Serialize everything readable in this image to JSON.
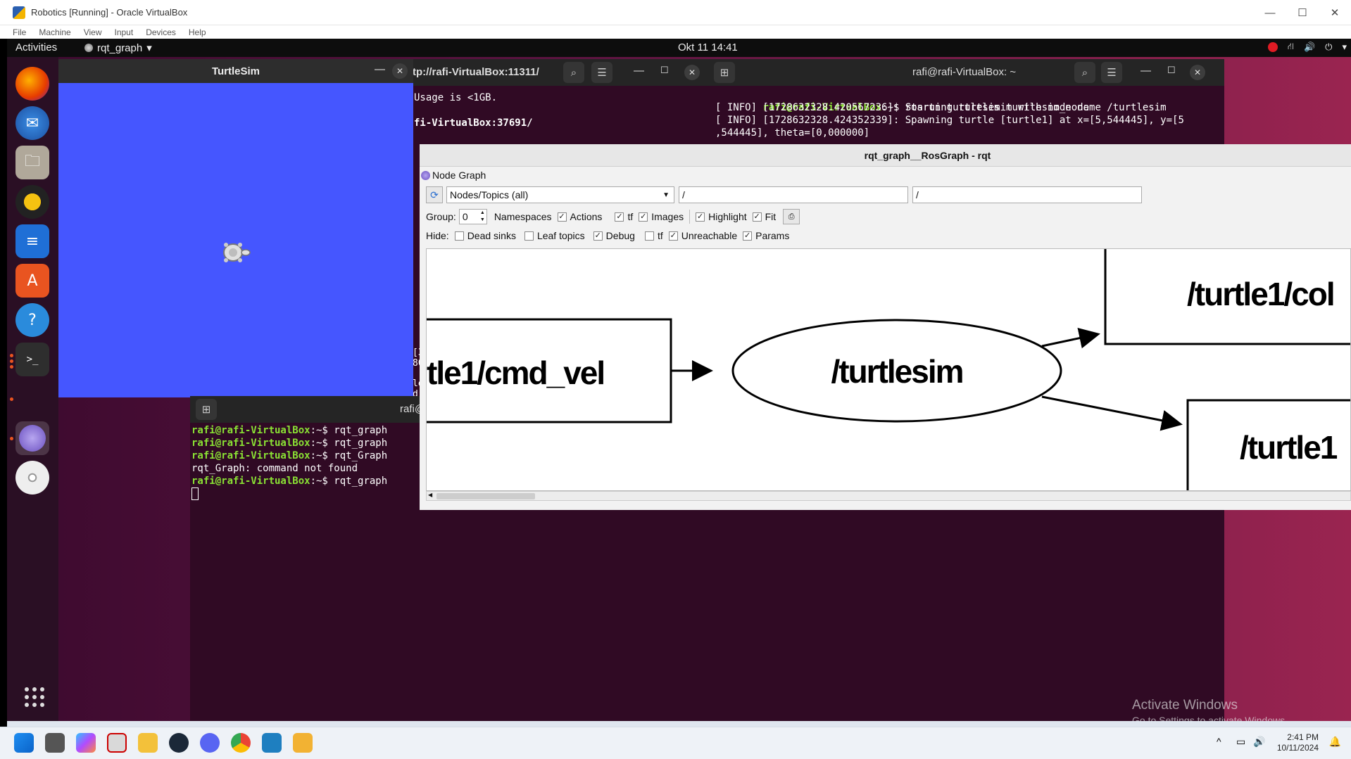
{
  "vbox": {
    "title": "Robotics [Running] - Oracle VirtualBox",
    "menu": [
      "File",
      "Machine",
      "View",
      "Input",
      "Devices",
      "Help"
    ]
  },
  "topbar": {
    "activities": "Activities",
    "app_name": "rqt_graph",
    "clock": "Okt 11  14:41"
  },
  "turtlesim": {
    "title": "TurtleSim"
  },
  "terminal_back": {
    "title": "tp://rafi-VirtualBox:11311/",
    "lines": [
      "Usage is <1GB.",
      "",
      "fi-VirtualBox:37691/"
    ],
    "fragments": [
      "[3",
      "80",
      "le",
      "d"
    ]
  },
  "terminal_right": {
    "title": "rafi@rafi-VirtualBox: ~",
    "prompt": "rafi@rafi-VirtualBox",
    "prompt_suffix": ":~$ ",
    "command": "rosrun turtlesim turtlesim_node",
    "lines": [
      "[ INFO] [1728632328.420567236]: Starting turtlesim with node name /turtlesim",
      "[ INFO] [1728632328.424352339]: Spawning turtle [turtle1] at x=[5,544445], y=[5",
      ",544445], theta=[0,000000]"
    ]
  },
  "terminal_front": {
    "title": "rafi@",
    "prompt": "rafi@rafi-VirtualBox",
    "prompt_suffix": ":~$ ",
    "commands": [
      "rqt_graph",
      "rqt_graph",
      "rqt_Graph",
      "rqt_graph"
    ],
    "error_line": "rqt_Graph: command not found"
  },
  "rqt": {
    "title": "rqt_graph__RosGraph - rqt",
    "plugin_title": "Node Graph",
    "mode_select": "Nodes/Topics (all)",
    "filter1": "/",
    "filter2": "/",
    "group_label": "Group:",
    "group_value": "0",
    "options": {
      "namespaces": "Namespaces",
      "actions": "Actions",
      "tf": "tf",
      "images": "Images",
      "highlight": "Highlight",
      "fit": "Fit"
    },
    "hide_label": "Hide:",
    "hide": {
      "dead_sinks": "Dead sinks",
      "leaf_topics": "Leaf topics",
      "debug": "Debug",
      "tf": "tf",
      "unreachable": "Unreachable",
      "params": "Params"
    },
    "graph": {
      "topic_cmd_vel": "tle1/cmd_vel",
      "node_turtlesim": "/turtlesim",
      "topic_col": "/turtle1/col",
      "topic_turtle1": "/turtle1"
    }
  },
  "watermark": {
    "title": "Activate Windows",
    "subtitle": "Go to Settings to activate Windows."
  },
  "taskbar": {
    "time": "2:41 PM",
    "date": "10/11/2024"
  },
  "colors": {
    "turtlesim_bg": "#4556ff",
    "terminal_bg": "#300a24",
    "prompt": "#8ae234",
    "ubuntu_orange": "#e95420"
  }
}
